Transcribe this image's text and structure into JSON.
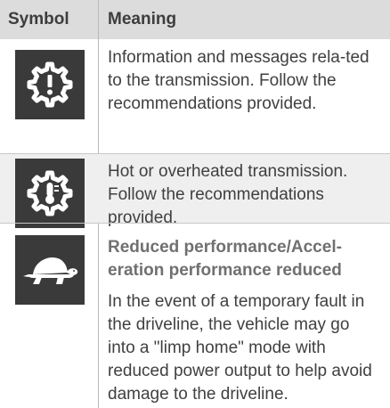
{
  "table": {
    "headers": {
      "symbol": "Symbol",
      "meaning": "Meaning"
    },
    "rows": [
      {
        "icon": "transmission-warning-icon",
        "text": "Information and messages rela-ted to the transmission. Follow the recommendations provided."
      },
      {
        "icon": "transmission-temperature-icon",
        "text": "Hot or overheated transmission. Follow the recommendations provided."
      },
      {
        "icon": "turtle-icon",
        "subtitle": "Reduced performance/Accel-eration performance reduced",
        "text": "In the event of a temporary fault in the driveline, the vehicle may go into a \"limp home\" mode with reduced power output to help avoid damage to the driveline."
      }
    ]
  },
  "colors": {
    "header_bg": "#dcdcdc",
    "shaded_row_bg": "#efefef",
    "icon_bg": "#3a3a3a",
    "icon_fg": "#ffffff"
  }
}
